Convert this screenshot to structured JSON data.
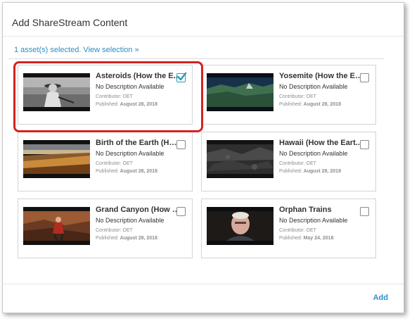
{
  "dialog": {
    "title": "Add ShareStream Content",
    "selection_link": "1 asset(s) selected. View selection »",
    "add_button": "Add"
  },
  "cards": [
    {
      "title": "Asteroids (How the E...",
      "description": "No Description Available",
      "contributor": "Contributor: OET",
      "published_label": "Published:",
      "published_date": "August 28, 2018",
      "checked": true
    },
    {
      "title": "Yosemite (How the Ea...",
      "description": "No Description Available",
      "contributor": "Contributor: OET",
      "published_label": "Published:",
      "published_date": "August 28, 2018",
      "checked": false
    },
    {
      "title": "Birth of the Earth (Ho...",
      "description": "No Description Available",
      "contributor": "Contributor: OET",
      "published_label": "Published:",
      "published_date": "August 28, 2018",
      "checked": false
    },
    {
      "title": "Hawaii (How the Eart...",
      "description": "No Description Available",
      "contributor": "Contributor: OET",
      "published_label": "Published:",
      "published_date": "August 28, 2018",
      "checked": false
    },
    {
      "title": "Grand Canyon (How t...",
      "description": "No Description Available",
      "contributor": "Contributor: OET",
      "published_label": "Published:",
      "published_date": "August 28, 2018",
      "checked": false
    },
    {
      "title": "Orphan Trains",
      "description": "No Description Available",
      "contributor": "Contributor: OET",
      "published_label": "Published:",
      "published_date": "May 24, 2018",
      "checked": false
    }
  ],
  "colors": {
    "accent": "#2d8ec3",
    "checkbox_checked": "#2a9bb5",
    "highlight": "#d42323"
  }
}
